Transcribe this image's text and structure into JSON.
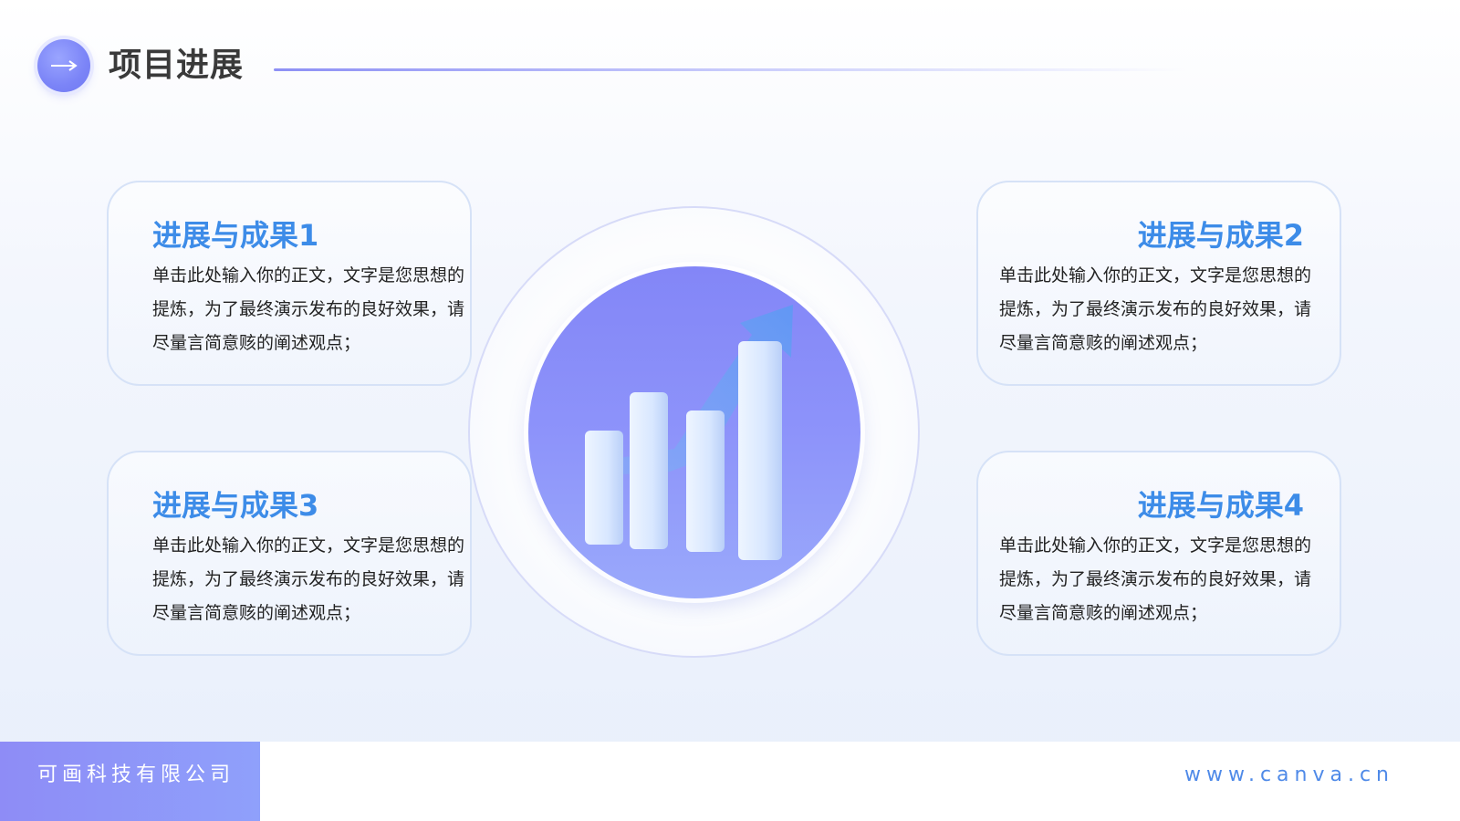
{
  "header": {
    "icon": "arrow-right-icon",
    "title": "项目进展"
  },
  "cards": [
    {
      "title": "进展与成果1",
      "body": "单击此处输入你的正文，文字是您思想的提炼，为了最终演示发布的良好效果，请尽量言简意赅的阐述观点；"
    },
    {
      "title": "进展与成果2",
      "body": "单击此处输入你的正文，文字是您思想的提炼，为了最终演示发布的良好效果，请尽量言简意赅的阐述观点；"
    },
    {
      "title": "进展与成果3",
      "body": "单击此处输入你的正文，文字是您思想的提炼，为了最终演示发布的良好效果，请尽量言简意赅的阐述观点；"
    },
    {
      "title": "进展与成果4",
      "body": "单击此处输入你的正文，文字是您思想的提炼，为了最终演示发布的良好效果，请尽量言简意赅的阐述观点；"
    }
  ],
  "center_graphic": {
    "icon": "growth-bar-chart-icon"
  },
  "footer": {
    "company": "可画科技有限公司",
    "url": "www.canva.cn"
  },
  "colors": {
    "accent": "#3d8ce8",
    "purple": "#8386f7",
    "text": "#222222"
  }
}
